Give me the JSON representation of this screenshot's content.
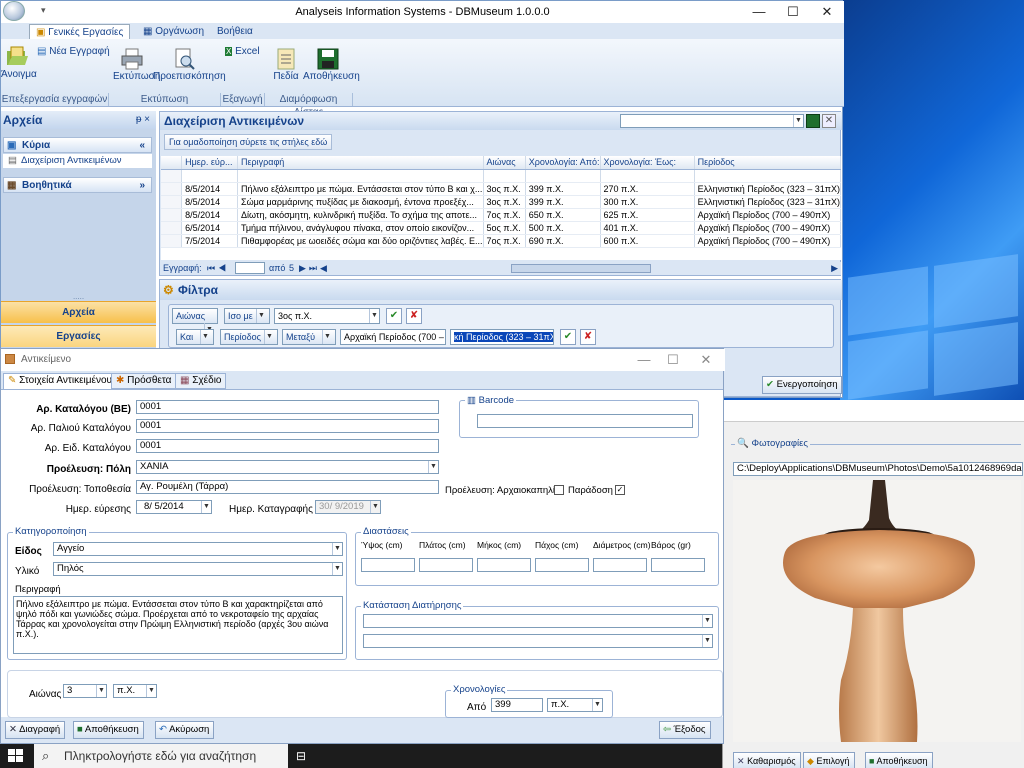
{
  "main": {
    "title": "Analyseis Information Systems - DBMuseum 1.0.0.0",
    "ribbon_tabs": [
      "Γενικές Εργασίες",
      "Οργάνωση",
      "Βοήθεια"
    ],
    "buttons": {
      "open": "Άνοιγμα",
      "new_record": "Νέα Εγγραφή",
      "print": "Εκτύπωση",
      "preview": "Προεπισκόπηση",
      "excel": "Excel",
      "fields": "Πεδία",
      "save": "Αποθήκευση"
    },
    "groups": [
      "Επεξεργασία εγγραφών",
      "Εκτύπωση",
      "Εξαγωγή",
      "Διαμόρφωση Λίστας"
    ]
  },
  "archives": {
    "title": "Αρχεία",
    "pin": "ᵽ ×",
    "main_section": "Κύρια",
    "main_item": "Διαχείριση Αντικειμένων",
    "aux_section": "Βοηθητικά",
    "nav": [
      "Αρχεία",
      "Εργασίες"
    ]
  },
  "grid": {
    "title": "Διαχείριση Αντικειμένων",
    "group_hint": "Για ομαδοποίηση σύρετε τις στήλες εδώ",
    "columns": [
      "Ημερ. εύρ...",
      "Περιγραφή",
      "Αιώνας",
      "Χρονολογία: Από:",
      "Χρονολογία: Έως:",
      "Περίοδος"
    ],
    "rows": [
      [
        "8/5/2014",
        "Πήλινο εξάλειπτρο με πώμα. Εντάσσεται στον τύπο Β και χ...",
        "3ος π.Χ.",
        "399 π.Χ.",
        "270 π.Χ.",
        "Ελληνιστική Περίοδος (323 – 31πΧ)"
      ],
      [
        "8/5/2014",
        "Σώμα μαρμάρινης πυξίδας με διακοσμή, έντονα προεξέχ...",
        "3ος π.Χ.",
        "399 π.Χ.",
        "300 π.Χ.",
        "Ελληνιστική Περίοδος (323 – 31πΧ)"
      ],
      [
        "8/5/2014",
        "Δίωτη, ακόσμητη, κυλινδρική πυξίδα. Το σχήμα της αποτε...",
        "7ος π.Χ.",
        "650 π.Χ.",
        "625 π.Χ.",
        "Αρχαϊκή Περίοδος (700 – 490πΧ)"
      ],
      [
        "6/5/2014",
        "Τμήμα πήλινου, ανάγλυφου πίνακα, στον οποίο εικονίζον...",
        "5ος π.Χ.",
        "500 π.Χ.",
        "401 π.Χ.",
        "Αρχαϊκή Περίοδος (700 – 490πΧ)"
      ],
      [
        "7/5/2014",
        "Πιθαμφορέας με ωοειδές σώμα και δύο οριζόντιες λαβές. Ε...",
        "7ος π.Χ.",
        "690 π.Χ.",
        "600 π.Χ.",
        "Αρχαϊκή Περίοδος (700 – 490πΧ)"
      ]
    ],
    "nav_label": "Εγγραφή:",
    "nav_of": "από",
    "nav_total": "5"
  },
  "filters": {
    "title": "Φίλτρα",
    "row1": {
      "field": "Αιώνας",
      "op": "Ισο με",
      "value": "3ος π.Χ."
    },
    "row2": {
      "conj": "Και",
      "field": "Περίοδος",
      "op": "Μεταξύ",
      "from": "Αρχαϊκή Περίοδος (700 –",
      "to": "κή Περίοδος (323 – 31πΧ)"
    },
    "activate": "Ενεργοποίηση"
  },
  "photos": {
    "title": "Φωτογραφίες",
    "path": "C:\\Deploy\\Applications\\DBMuseum\\Photos\\Demo\\5a1012468969da0393a8ec",
    "clear": "Καθαρισμός",
    "select": "Επιλογή",
    "save": "Αποθήκευση"
  },
  "dialog": {
    "title": "Αντικείμενο",
    "tabs": [
      "Στοιχεία Αντικειμένου",
      "Πρόσθετα",
      "Σχέδιο"
    ],
    "fields": {
      "cat_no_label": "Αρ. Καταλόγου (ΒΕ)",
      "cat_no": "0001",
      "old_cat_label": "Αρ. Παλιού Καταλόγου",
      "old_cat": "0001",
      "spec_cat_label": "Αρ. Ειδ. Καταλόγου",
      "spec_cat": "0001",
      "city_label": "Προέλευση: Πόλη",
      "city": "ΧΑΝΙΑ",
      "place_label": "Προέλευση: Τοποθεσία",
      "place": "Αγ. Ρουμέλη (Τάρρα)",
      "trade_label": "Προέλευση: Αρχαιοκαπηλία",
      "tradition_label": "Παράδοση",
      "found_label": "Ημερ. εύρεσης",
      "found": "8/ 5/2014",
      "reg_label": "Ημερ. Καταγραφής",
      "reg": "30/ 9/2019",
      "barcode_label": "Barcode"
    },
    "classification": {
      "title": "Κατηγοροποίηση",
      "kind_label": "Είδος",
      "kind": "Αγγείο",
      "material_label": "Υλικό",
      "material": "Πηλός",
      "desc_label": "Περιγραφή",
      "desc": "Πήλινο εξάλειπτρο με πώμα. Εντάσσεται στον τύπο Β και χαρακτηρίζεται από ψηλό πόδι και γωνιώδες σώμα. Προέρχεται από το νεκροταφείο της αρχαίας Τάρρας και χρονολογείται στην Πρώιμη Ελληνιστική περίοδο (αρχές 3ου αιώνα π.Χ.)."
    },
    "dimensions": {
      "title": "Διαστάσεις",
      "cols": [
        "Ύψος (cm)",
        "Πλάτος (cm)",
        "Μήκος (cm)",
        "Πάχος (cm)",
        "Διάμετρος (cm)",
        "Βάρος (gr)"
      ]
    },
    "conservation": {
      "title": "Κατάσταση Διατήρησης"
    },
    "century": {
      "label": "Αιώνας",
      "value": "3",
      "era": "π.Χ."
    },
    "chronology": {
      "title": "Χρονολογίες",
      "from_label": "Από",
      "from": "399",
      "era": "π.Χ."
    },
    "buttons": {
      "delete": "Διαγραφή",
      "save": "Αποθήκευση",
      "cancel": "Ακύρωση",
      "exit": "Έξοδος"
    }
  },
  "taskbar": {
    "search": "Πληκτρολογήστε εδώ για αναζήτηση"
  }
}
